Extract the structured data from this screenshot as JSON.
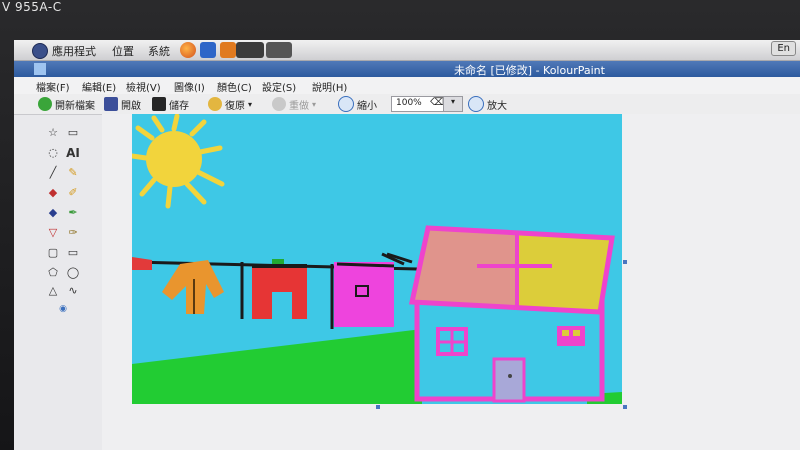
{
  "monitor": {
    "model_label": "V 955A-C"
  },
  "panel": {
    "applications": "應用程式",
    "places": "位置",
    "system": "系統",
    "keyboard_indicator": "En"
  },
  "window": {
    "title": "未命名 [已修改] - KolourPaint"
  },
  "menu": {
    "file": "檔案(F)",
    "edit": "編輯(E)",
    "view": "檢視(V)",
    "image": "圖像(I)",
    "colors": "顏色(C)",
    "settings": "設定(S)",
    "help": "說明(H)"
  },
  "toolbar": {
    "new": "開新檔案",
    "open": "開啟",
    "save": "儲存",
    "undo": "復原",
    "redo": "重做",
    "zoom_out": "縮小",
    "zoom_value": "100%",
    "zoom_in": "放大"
  },
  "tools": {
    "text_tool": "AI"
  },
  "colors": {
    "sky": "#3ec8e6",
    "grass": "#22cc33",
    "sun": "#f2d43c",
    "house_wall": "#3ec8e6",
    "house_outline": "#ee44cc",
    "roof_left": "#e0948c",
    "roof_right": "#dccd3a",
    "shirt": "#e9952e",
    "pants": "#e63535",
    "magenta_shirt": "#ee44dd",
    "door": "#a8a8d8"
  }
}
